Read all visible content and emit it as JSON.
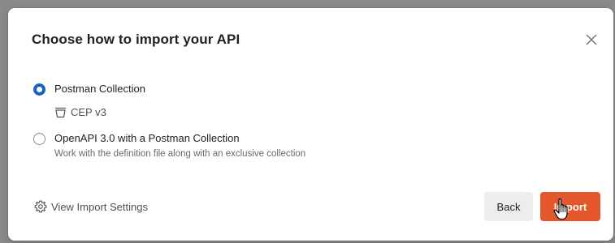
{
  "dialog": {
    "title": "Choose how to import your API",
    "options": [
      {
        "label": "Postman Collection",
        "selected": true,
        "sub_label": "CEP v3",
        "sub_icon": "collection-icon"
      },
      {
        "label": "OpenAPI 3.0 with a Postman Collection",
        "selected": false,
        "description": "Work with the definition file along with an exclusive collection"
      }
    ],
    "settings_link": "View Import Settings",
    "buttons": {
      "back": "Back",
      "import": "Import"
    }
  },
  "colors": {
    "accent": "#1565c0",
    "primary_button": "#e4572c",
    "secondary_button": "#ededed"
  },
  "icons": {
    "close": "close-icon",
    "settings": "gear-icon",
    "cursor": "hand-pointer-icon"
  }
}
